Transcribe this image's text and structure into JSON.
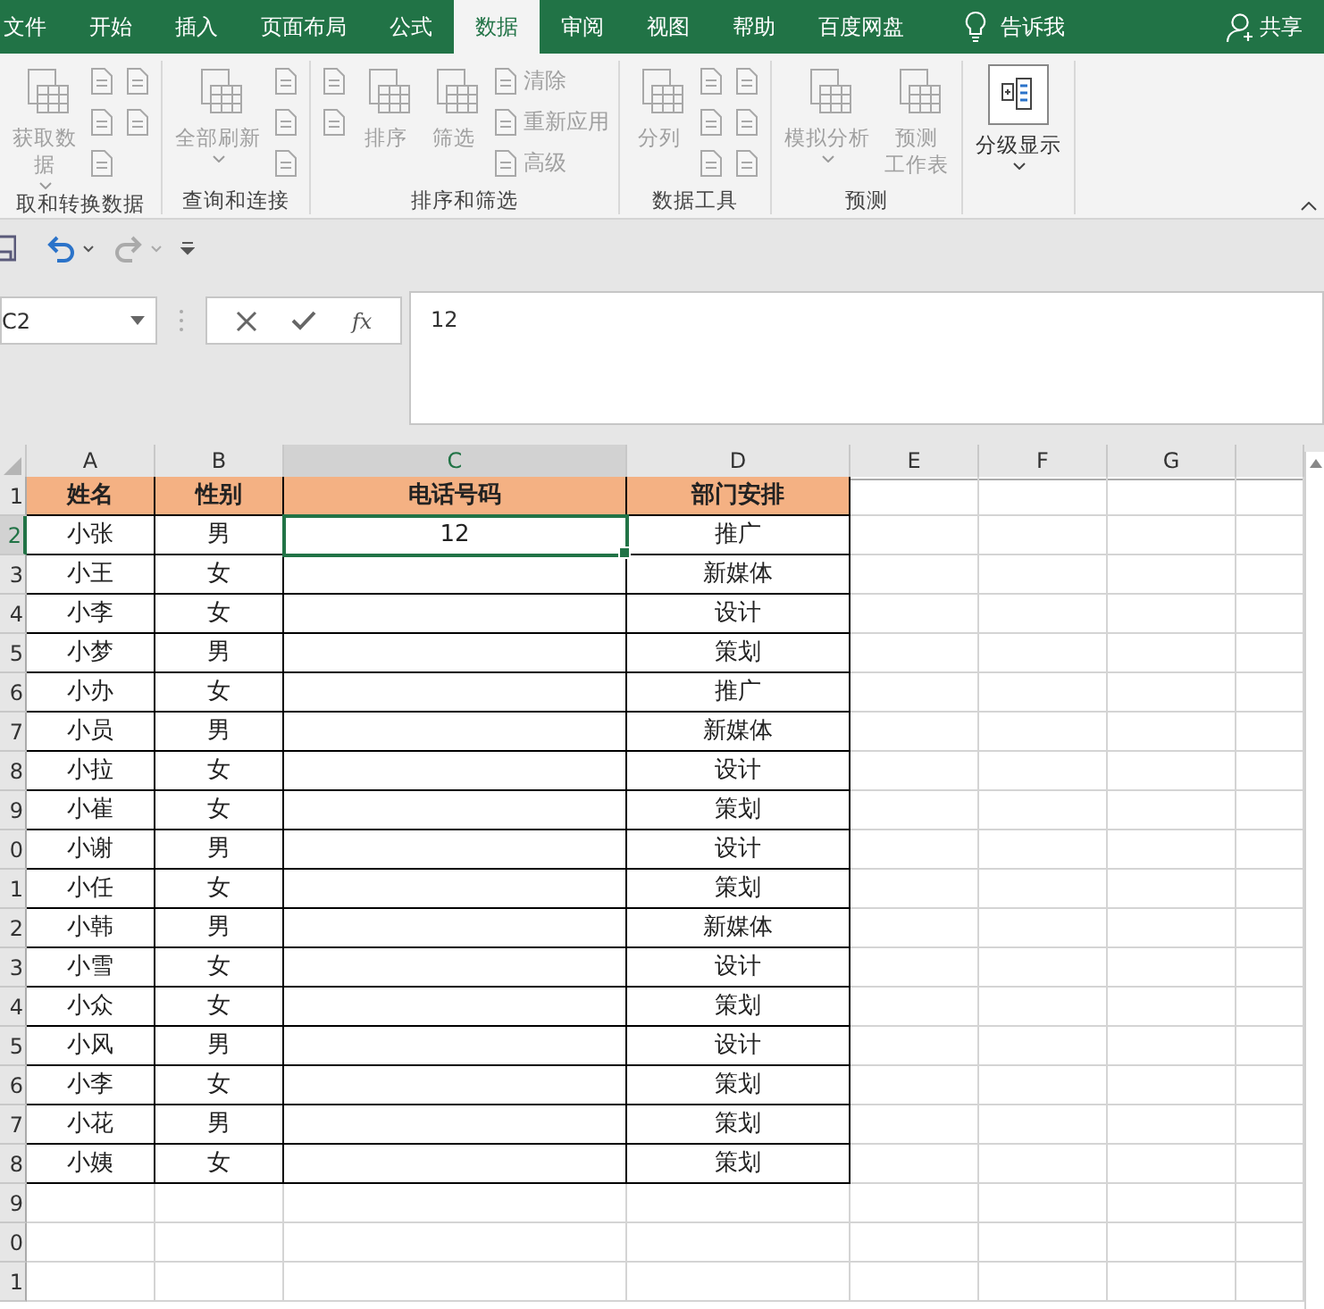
{
  "tabs": [
    {
      "label": "文件",
      "selected": false
    },
    {
      "label": "开始",
      "selected": false
    },
    {
      "label": "插入",
      "selected": false
    },
    {
      "label": "页面布局",
      "selected": false
    },
    {
      "label": "公式",
      "selected": false
    },
    {
      "label": "数据",
      "selected": true
    },
    {
      "label": "审阅",
      "selected": false
    },
    {
      "label": "视图",
      "selected": false
    },
    {
      "label": "帮助",
      "selected": false
    },
    {
      "label": "百度网盘",
      "selected": false
    }
  ],
  "tell_me": "告诉我",
  "share": "共享",
  "ribbon_groups": [
    {
      "label": "取和转换数据",
      "columns": [
        {
          "kind": "large",
          "label": [
            "获取数",
            "据"
          ],
          "disabled": true,
          "dropdown": true
        },
        {
          "kind": "stack",
          "items": [
            {
              "disabled": true
            },
            {
              "disabled": true
            },
            {
              "disabled": true
            }
          ]
        },
        {
          "kind": "stack",
          "items": [
            {
              "disabled": true
            },
            {
              "disabled": true
            }
          ]
        }
      ]
    },
    {
      "label": "查询和连接",
      "columns": [
        {
          "kind": "large",
          "label": [
            "全部刷新"
          ],
          "disabled": true,
          "dropdown": true
        },
        {
          "kind": "stack",
          "items": [
            {
              "disabled": true
            },
            {
              "disabled": true
            },
            {
              "disabled": true
            }
          ]
        }
      ]
    },
    {
      "label": "排序和筛选",
      "columns": [
        {
          "kind": "stack",
          "items": [
            {
              "disabled": true
            },
            {
              "disabled": true
            }
          ]
        },
        {
          "kind": "large",
          "label": [
            "排序"
          ],
          "disabled": true,
          "dropdown": false
        },
        {
          "kind": "large",
          "label": [
            "筛选"
          ],
          "disabled": true,
          "dropdown": false
        },
        {
          "kind": "stack",
          "items": [
            {
              "label": "清除",
              "disabled": true
            },
            {
              "label": "重新应用",
              "disabled": true
            },
            {
              "label": "高级",
              "disabled": true
            }
          ]
        }
      ]
    },
    {
      "label": "数据工具",
      "columns": [
        {
          "kind": "large",
          "label": [
            "分列"
          ],
          "disabled": true,
          "dropdown": false
        },
        {
          "kind": "stack",
          "items": [
            {
              "disabled": true
            },
            {
              "disabled": true
            },
            {
              "disabled": true
            }
          ]
        },
        {
          "kind": "stack",
          "items": [
            {
              "disabled": true
            },
            {
              "disabled": true
            },
            {
              "disabled": true
            }
          ]
        }
      ]
    },
    {
      "label": "预测",
      "columns": [
        {
          "kind": "large",
          "label": [
            "模拟分析"
          ],
          "disabled": true,
          "dropdown": true
        },
        {
          "kind": "large",
          "label": [
            "预测",
            "工作表"
          ],
          "disabled": true,
          "dropdown": false
        }
      ]
    },
    {
      "columns": [
        {
          "kind": "large",
          "label": [
            "分级显示"
          ],
          "disabled": false,
          "dropdown": true
        }
      ]
    }
  ],
  "name_box": "C2",
  "insert_function": "fx",
  "formula": "12",
  "sheet": {
    "columns": [
      {
        "label": "A",
        "selected": false
      },
      {
        "label": "B",
        "selected": false
      },
      {
        "label": "C",
        "selected": true
      },
      {
        "label": "D",
        "selected": false
      },
      {
        "label": "E",
        "selected": false
      },
      {
        "label": "F",
        "selected": false
      },
      {
        "label": "G",
        "selected": false
      }
    ],
    "rows": [
      {
        "number": "1",
        "selected": false,
        "kind": "header",
        "cells": [
          "姓名",
          "性别",
          "电话号码",
          "部门安排"
        ]
      },
      {
        "number": "2",
        "selected": true,
        "kind": "data",
        "cells": [
          "小张",
          "男",
          "12",
          "推广"
        ]
      },
      {
        "number": "3",
        "selected": false,
        "kind": "data",
        "cells": [
          "小王",
          "女",
          "",
          "新媒体"
        ]
      },
      {
        "number": "4",
        "selected": false,
        "kind": "data",
        "cells": [
          "小李",
          "女",
          "",
          "设计"
        ]
      },
      {
        "number": "5",
        "selected": false,
        "kind": "data",
        "cells": [
          "小梦",
          "男",
          "",
          "策划"
        ]
      },
      {
        "number": "6",
        "selected": false,
        "kind": "data",
        "cells": [
          "小办",
          "女",
          "",
          "推广"
        ]
      },
      {
        "number": "7",
        "selected": false,
        "kind": "data",
        "cells": [
          "小员",
          "男",
          "",
          "新媒体"
        ]
      },
      {
        "number": "8",
        "selected": false,
        "kind": "data",
        "cells": [
          "小拉",
          "女",
          "",
          "设计"
        ]
      },
      {
        "number": "9",
        "selected": false,
        "kind": "data",
        "cells": [
          "小崔",
          "女",
          "",
          "策划"
        ]
      },
      {
        "number": "0",
        "selected": false,
        "kind": "data",
        "cells": [
          "小谢",
          "男",
          "",
          "设计"
        ]
      },
      {
        "number": "1",
        "selected": false,
        "kind": "data",
        "cells": [
          "小任",
          "女",
          "",
          "策划"
        ]
      },
      {
        "number": "2",
        "selected": false,
        "kind": "data",
        "cells": [
          "小韩",
          "男",
          "",
          "新媒体"
        ]
      },
      {
        "number": "3",
        "selected": false,
        "kind": "data",
        "cells": [
          "小雪",
          "女",
          "",
          "设计"
        ]
      },
      {
        "number": "4",
        "selected": false,
        "kind": "data",
        "cells": [
          "小众",
          "女",
          "",
          "策划"
        ]
      },
      {
        "number": "5",
        "selected": false,
        "kind": "data",
        "cells": [
          "小风",
          "男",
          "",
          "设计"
        ]
      },
      {
        "number": "6",
        "selected": false,
        "kind": "data",
        "cells": [
          "小李",
          "女",
          "",
          "策划"
        ]
      },
      {
        "number": "7",
        "selected": false,
        "kind": "data",
        "cells": [
          "小花",
          "男",
          "",
          "策划"
        ]
      },
      {
        "number": "8",
        "selected": false,
        "kind": "data",
        "cells": [
          "小姨",
          "女",
          "",
          "策划"
        ]
      },
      {
        "number": "9",
        "selected": false
      },
      {
        "number": "0",
        "selected": false
      },
      {
        "number": "1",
        "selected": false
      }
    ]
  }
}
